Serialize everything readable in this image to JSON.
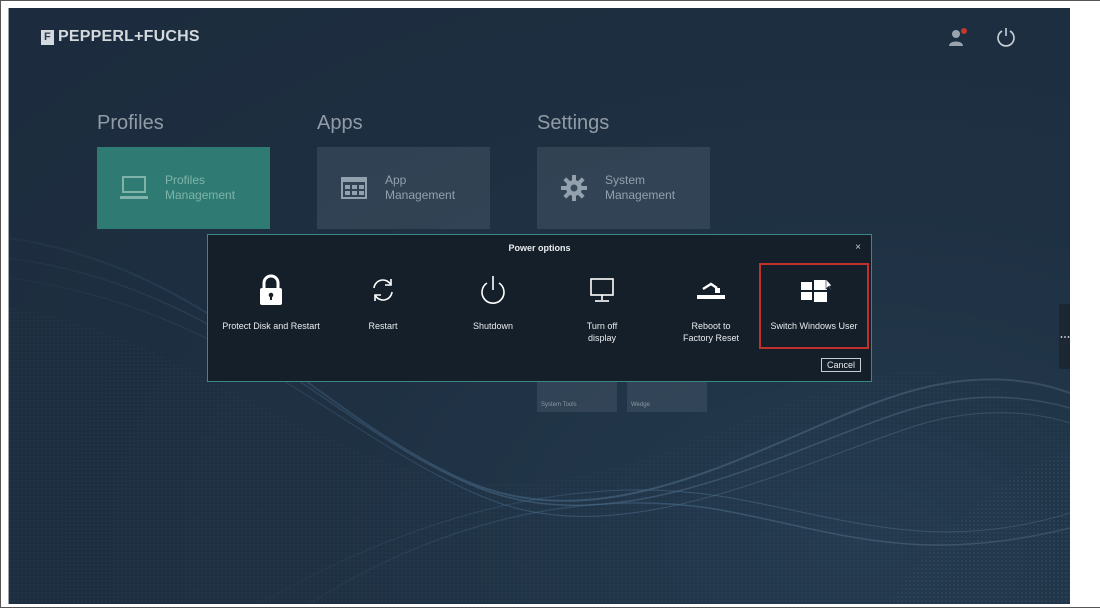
{
  "header": {
    "logo_mark": "F",
    "brand": "PEPPERL+FUCHS"
  },
  "sections": [
    {
      "title": "Profiles",
      "tile": {
        "line1": "Profiles",
        "line2": "Management",
        "icon": "monitor-icon",
        "active": true
      }
    },
    {
      "title": "Apps",
      "tile": {
        "line1": "App",
        "line2": "Management",
        "icon": "app-grid-icon",
        "active": false
      }
    },
    {
      "title": "Settings",
      "tile": {
        "line1": "System",
        "line2": "Management",
        "icon": "gear-icon",
        "active": false
      }
    }
  ],
  "small_tiles": [
    "System Tools",
    "Wedge"
  ],
  "side_tab_label": "⋮",
  "dialog": {
    "title": "Power options",
    "close": "×",
    "options": [
      {
        "label": "Protect Disk and Restart",
        "icon": "lock-icon"
      },
      {
        "label": "Restart",
        "icon": "refresh-icon"
      },
      {
        "label": "Shutdown",
        "icon": "power-icon"
      },
      {
        "label": "Turn off display",
        "icon": "monitor-icon"
      },
      {
        "label": "Reboot to Factory Reset",
        "icon": "factory-reset-icon"
      },
      {
        "label": "Switch Windows User",
        "icon": "windows-icon",
        "highlighted": true
      }
    ],
    "cancel": "Cancel"
  },
  "colors": {
    "accent_tile": "#2f7b73",
    "dialog_border": "#3a8a82",
    "highlight": "#c0312d"
  }
}
